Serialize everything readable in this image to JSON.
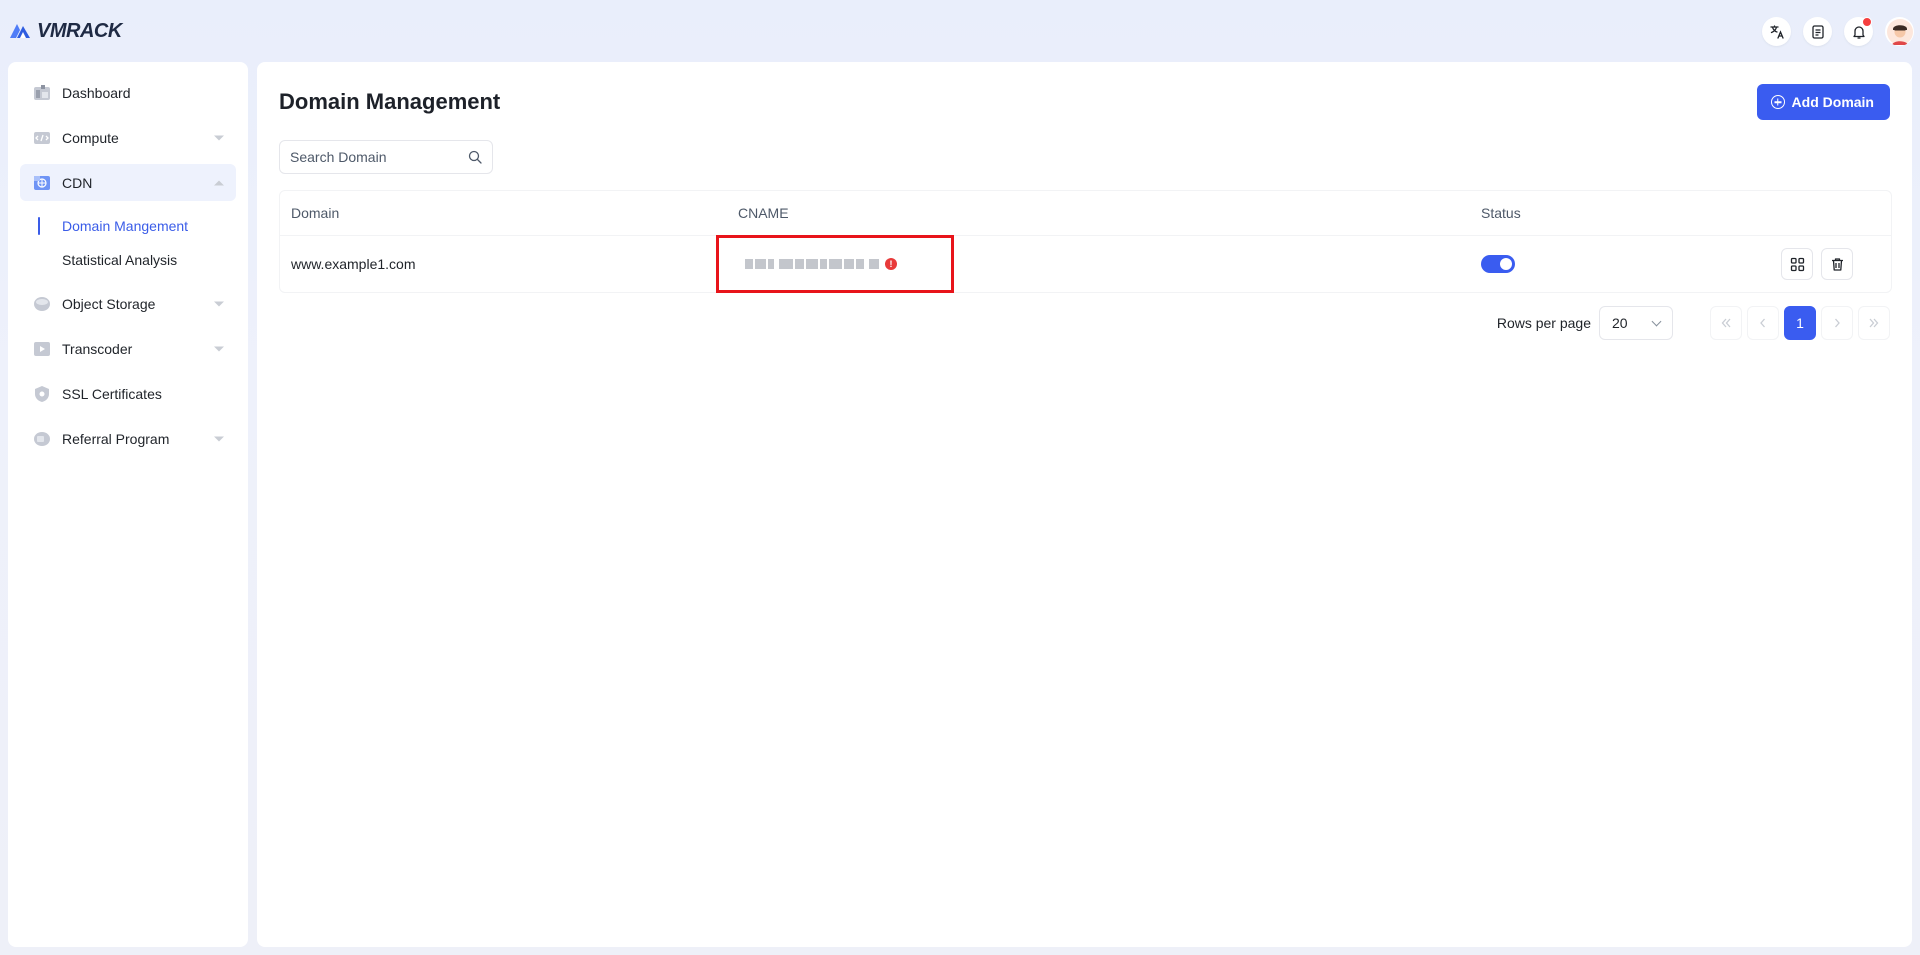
{
  "brand": {
    "name": "VMRACK"
  },
  "topbar": {
    "icons": [
      "translate-icon",
      "docs-icon",
      "bell-icon",
      "avatar"
    ]
  },
  "sidebar": {
    "items": [
      {
        "label": "Dashboard",
        "icon": "dashboard-icon",
        "expandable": false
      },
      {
        "label": "Compute",
        "icon": "compute-icon",
        "expandable": true
      },
      {
        "label": "CDN",
        "icon": "cdn-icon",
        "expandable": true,
        "expanded": true,
        "children": [
          {
            "label": "Domain Mangement",
            "active": true
          },
          {
            "label": "Statistical Analysis",
            "active": false
          }
        ]
      },
      {
        "label": "Object Storage",
        "icon": "storage-icon",
        "expandable": true
      },
      {
        "label": "Transcoder",
        "icon": "transcoder-icon",
        "expandable": true
      },
      {
        "label": "SSL Certificates",
        "icon": "ssl-icon",
        "expandable": false
      },
      {
        "label": "Referral Program",
        "icon": "referral-icon",
        "expandable": true
      }
    ]
  },
  "main": {
    "title": "Domain Management",
    "add_button": "Add Domain",
    "search": {
      "placeholder": "Search Domain",
      "value": ""
    },
    "table": {
      "columns": [
        "Domain",
        "CNAME",
        "Status",
        ""
      ],
      "rows": [
        {
          "domain": "www.example1.com",
          "cname": "",
          "cname_status": "error",
          "enabled": true
        }
      ]
    },
    "pagination": {
      "rows_label": "Rows per page",
      "rows_value": "20",
      "current_page": "1"
    }
  },
  "colors": {
    "accent": "#3a5cf0",
    "highlight_box": "#e8141a",
    "error": "#e83a3a"
  }
}
